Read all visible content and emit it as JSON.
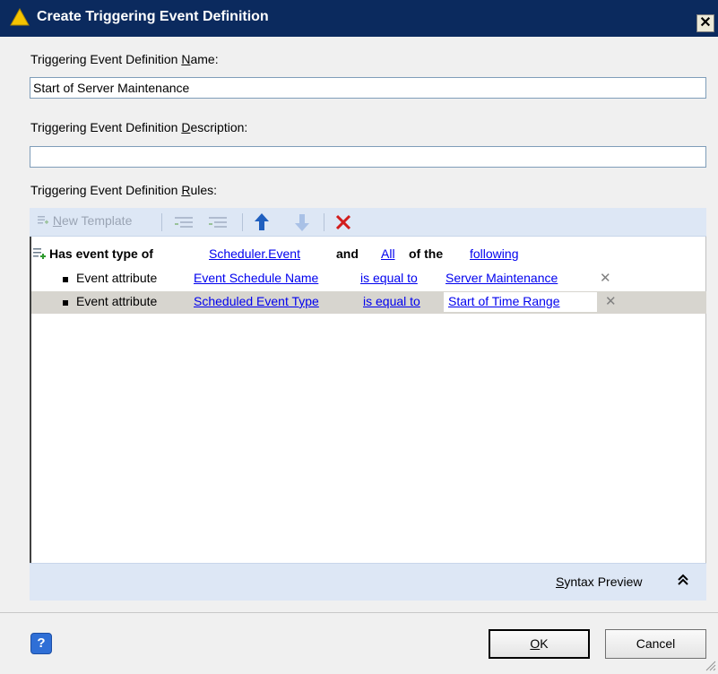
{
  "window": {
    "title": "Create Triggering Event Definition",
    "close_label": "✕"
  },
  "form": {
    "name_label_pre": "Triggering Event Definition ",
    "name_label_key": "N",
    "name_label_post": "ame:",
    "name_value": "Start of Server Maintenance",
    "description_label_pre": "Triggering Event Definition ",
    "description_label_key": "D",
    "description_label_post": "escription:",
    "description_value": "",
    "rules_label_pre": "Triggering Event Definition ",
    "rules_label_key": "R",
    "rules_label_post": "ules:"
  },
  "toolbar": {
    "new_template_key": "N",
    "new_template_rest": "ew Template"
  },
  "rules": {
    "header": {
      "prefix": "Has event type of",
      "event_type": "Scheduler.Event",
      "and": "and",
      "quantifier": "All",
      "of_the": "of the",
      "following": "following"
    },
    "conditions": [
      {
        "label": "Event attribute",
        "attribute": "Event Schedule Name",
        "operator": "is equal to",
        "value": "Server Maintenance",
        "delete": "✕"
      },
      {
        "label": "Event attribute",
        "attribute": "Scheduled Event Type",
        "operator": "is equal to",
        "value": "Start of Time Range",
        "delete": "✕",
        "selected": true
      }
    ]
  },
  "syntax_preview": {
    "key": "S",
    "rest": "yntax Preview",
    "chevron": "»"
  },
  "buttons": {
    "help": "?",
    "ok_key": "O",
    "ok_rest": "K",
    "cancel": "Cancel"
  },
  "colors": {
    "titlebar": "#0b2a5e",
    "toolbar": "#dde7f5",
    "link": "#0000ee",
    "delete_red": "#d21c1c",
    "up_arrow": "#1f5fbf"
  }
}
